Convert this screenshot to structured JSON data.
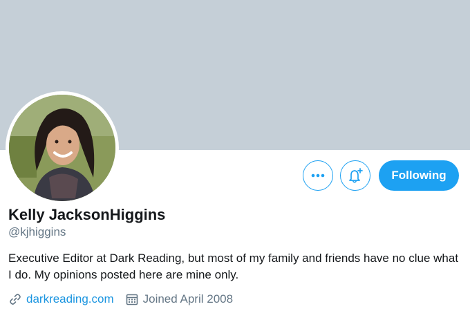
{
  "profile": {
    "name": "Kelly JacksonHiggins",
    "handle": "@kjhiggins",
    "bio": "Executive Editor at Dark Reading, but most of my family and friends have no clue what I do. My opinions posted here are mine only.",
    "website": "darkreading.com",
    "joined": "Joined April 2008"
  },
  "actions": {
    "more_icon": "more-dots-icon",
    "notify_icon": "bell-plus-icon",
    "follow_label": "Following"
  },
  "colors": {
    "banner": "#c5cfd7",
    "accent": "#1da1f2",
    "text_secondary": "#657786"
  },
  "icons": {
    "website": "link-icon",
    "joined": "calendar-icon"
  }
}
